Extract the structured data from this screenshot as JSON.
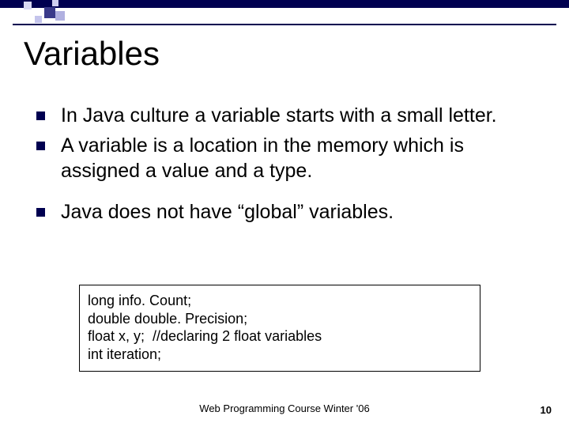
{
  "title": "Variables",
  "bullets": [
    " In Java culture a variable starts with a small letter.",
    " A variable is a location in the memory which is assigned a value and a type.",
    " Java does not have “global” variables."
  ],
  "code": [
    "long info. Count;",
    "double double. Precision;",
    "float x, y;  //declaring 2 float variables",
    "int iteration;"
  ],
  "footer": "Web Programming Course Winter '06",
  "page_number": "10"
}
